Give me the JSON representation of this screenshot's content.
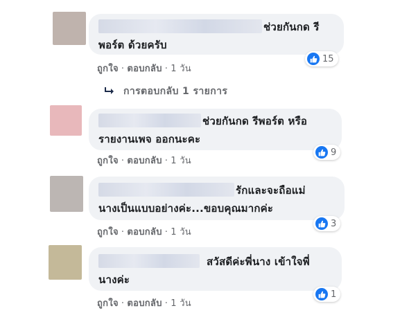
{
  "comments": [
    {
      "avatar_color": "#bfb3ad",
      "text_line1": "ช่วยกันกด รี",
      "text_line2": "พอร์ต ด้วยครับ",
      "reaction_count": "15",
      "like_label": "ถูกใจ",
      "reply_label": "ตอบกลับ",
      "time": "1 วัน"
    },
    {
      "avatar_color": "#e8b8bb",
      "text_line1": "ช่วยกันกด รีพอร์ต หรือ",
      "text_line2": "รายงานเพจ ออกนะคะ",
      "reaction_count": "9",
      "like_label": "ถูกใจ",
      "reply_label": "ตอบกลับ",
      "time": "1 วัน"
    },
    {
      "avatar_color": "#bcb6b3",
      "text_line1": "รักและจะถือแม่",
      "text_line2": "นางเป็นแบบอย่างค่ะ...ขอบคุณมากค่ะ",
      "reaction_count": "3",
      "like_label": "ถูกใจ",
      "reply_label": "ตอบกลับ",
      "time": "1 วัน"
    },
    {
      "avatar_color": "#c4b999",
      "text_line1": "สวัสดีค่ะพี่นาง เข้าใจพี่",
      "text_line2": "นางค่ะ",
      "reaction_count": "1",
      "like_label": "ถูกใจ",
      "reply_label": "ตอบกลับ",
      "time": "1 วัน"
    }
  ],
  "replies_link": "การตอบกลับ 1 รายการ",
  "colors": {
    "bubble_bg": "#f0f2f5",
    "like_blue": "#1877f2",
    "meta_gray": "#65676b"
  },
  "icons": {
    "like": "thumbs-up-icon",
    "reply_arrow": "reply-arrow-icon"
  }
}
